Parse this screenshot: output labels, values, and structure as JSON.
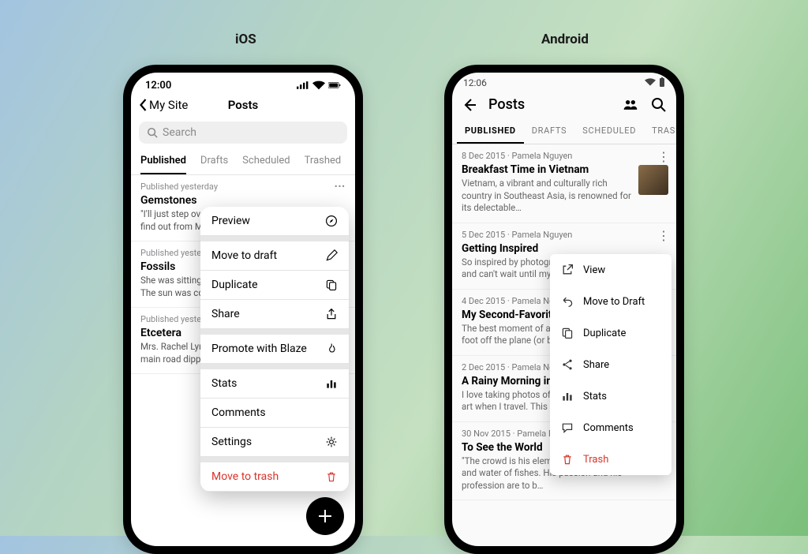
{
  "labels": {
    "ios": "iOS",
    "android": "Android"
  },
  "ios": {
    "time": "12:00",
    "back": "My Site",
    "title": "Posts",
    "search_placeholder": "Search",
    "tabs": [
      "Published",
      "Drafts",
      "Scheduled",
      "Trashed"
    ],
    "active_tab": 0,
    "posts": [
      {
        "meta": "Published yesterday",
        "title": "Gemstones",
        "excerpt": "\"I'll just step over to Green Gables after tea and find out from Marilla where he's gone and…"
      },
      {
        "meta": "Published yesterday",
        "title": "Fossils",
        "excerpt": "She was sitting there one afternoon in early June. The sun was coming in at the window war…"
      },
      {
        "meta": "Published yesterday",
        "title": "Etcetera",
        "excerpt": "Mrs. Rachel Lynde lived just where the Avonlea main road dipped down into a little holl…"
      }
    ],
    "menu": [
      {
        "label": "Preview",
        "icon": "compass"
      },
      {
        "gap": true
      },
      {
        "label": "Move to draft",
        "icon": "pencil"
      },
      {
        "label": "Duplicate",
        "icon": "copy"
      },
      {
        "label": "Share",
        "icon": "share-ios"
      },
      {
        "gap": true
      },
      {
        "label": "Promote with Blaze",
        "icon": "flame"
      },
      {
        "gap": true
      },
      {
        "label": "Stats",
        "icon": "stats"
      },
      {
        "label": "Comments",
        "icon": ""
      },
      {
        "label": "Settings",
        "icon": "gear"
      },
      {
        "gap": true
      },
      {
        "label": "Move to trash",
        "icon": "trash",
        "danger": true
      }
    ]
  },
  "android": {
    "time": "12:06",
    "title": "Posts",
    "tabs": [
      "PUBLISHED",
      "DRAFTS",
      "SCHEDULED",
      "TRASHED"
    ],
    "active_tab": 0,
    "posts": [
      {
        "meta": "8 Dec 2015  ·  Pamela Nguyen",
        "title": "Breakfast Time in Vietnam",
        "excerpt": "Vietnam, a vibrant and culturally rich country in Southeast Asia, is renowned for its delectable…",
        "thumb": true
      },
      {
        "meta": "5 Dec 2015  ·  Pamela Nguyen",
        "title": "Getting Inspired",
        "excerpt": "So inspired by photographers on Instagram and can't wait until my next trip…"
      },
      {
        "meta": "4 Dec 2015  ·  Pamela Nguyen",
        "title": "My Second-Favorite Part of Travel",
        "excerpt": "The best moment of any trip is when I step foot off the plane (or boat, or train)…"
      },
      {
        "meta": "2 Dec 2015  ·  Pamela Nguyen",
        "title": "A Rainy Morning in Northern Spain",
        "excerpt": "I love taking photos of murals and street art when I travel. This one's on a…"
      },
      {
        "meta": "30 Nov 2015  ·  Pamela Nguyen",
        "title": "To See the World",
        "excerpt": "\"The crowd is his element, as the air is that of birds and water of fishes. His passion and his profession are to b…"
      }
    ],
    "menu": [
      {
        "label": "View",
        "icon": "external"
      },
      {
        "label": "Move to Draft",
        "icon": "undo"
      },
      {
        "label": "Duplicate",
        "icon": "copy"
      },
      {
        "label": "Share",
        "icon": "share-and"
      },
      {
        "label": "Stats",
        "icon": "stats"
      },
      {
        "label": "Comments",
        "icon": "comment"
      },
      {
        "label": "Trash",
        "icon": "trash",
        "danger": true
      }
    ]
  }
}
